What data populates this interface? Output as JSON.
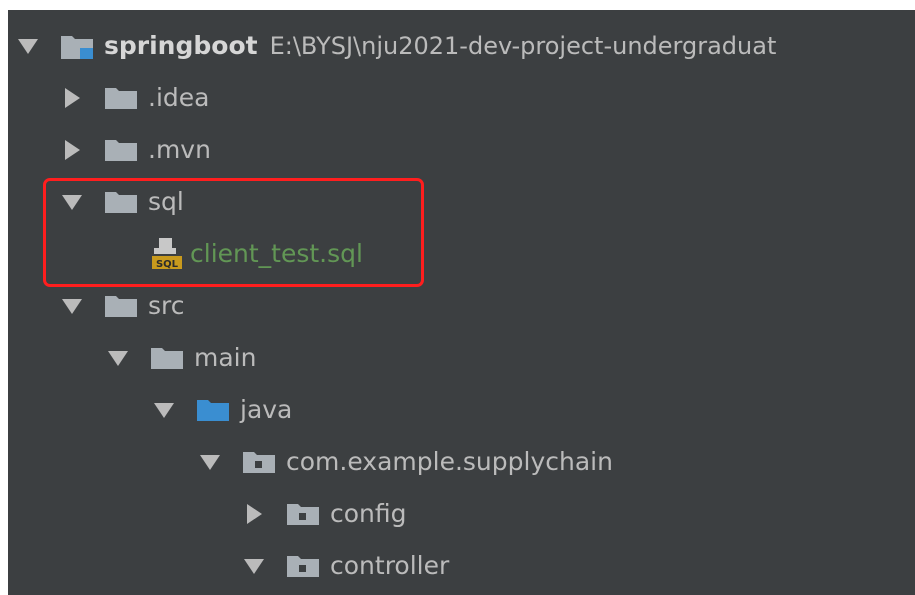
{
  "project_tree": {
    "root": {
      "name": "springboot",
      "path": "E:\\BYSJ\\nju2021-dev-project-undergraduat"
    },
    "items": [
      {
        "label": ".idea",
        "expanded": false,
        "icon": "folder-icon"
      },
      {
        "label": ".mvn",
        "expanded": false,
        "icon": "folder-icon"
      },
      {
        "label": "sql",
        "expanded": true,
        "icon": "folder-icon"
      },
      {
        "label": "client_test.sql",
        "icon": "sql-file-icon",
        "color": "#629755"
      },
      {
        "label": "src",
        "expanded": true,
        "icon": "folder-icon"
      },
      {
        "label": "main",
        "expanded": true,
        "icon": "folder-icon"
      },
      {
        "label": "java",
        "expanded": true,
        "icon": "source-folder-icon"
      },
      {
        "label": "com.example.supplychain",
        "expanded": true,
        "icon": "package-icon"
      },
      {
        "label": "config",
        "expanded": false,
        "icon": "package-icon"
      },
      {
        "label": "controller",
        "expanded": true,
        "icon": "package-icon"
      }
    ]
  },
  "colors": {
    "background": "#3c3f41",
    "text": "#bbbbbb",
    "folder": "#a9b0b6",
    "source_folder": "#3a8ed1",
    "highlight_border": "#ff1e1e",
    "sql_file_text": "#629755"
  }
}
